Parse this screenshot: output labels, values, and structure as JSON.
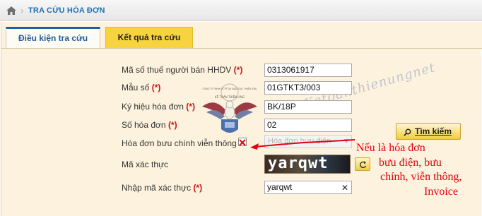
{
  "breadcrumb": {
    "title": "TRA CỨU HÓA ĐƠN",
    "home_icon": "home-icon"
  },
  "tabs": [
    {
      "label": "Điều kiện tra cứu",
      "active": true
    },
    {
      "label": "Kết quả tra cứu",
      "active": false
    }
  ],
  "form": {
    "seller_tax_code": {
      "label": "Mã số thuế người bán HHDV",
      "req": "(*)",
      "value": "0313061917"
    },
    "template_code": {
      "label": "Mẫu số",
      "req": "(*)",
      "value": "01GTKT3/003"
    },
    "serial": {
      "label": "Ký hiệu hóa đơn",
      "req": "(*)",
      "value": "BK/18P"
    },
    "invoice_no": {
      "label": "Số hóa đơn",
      "req": "(*)",
      "value": "02"
    },
    "postal_invoice": {
      "label": "Hóa đơn bưu chính viễn thông",
      "checked": true,
      "select_value": "Hóa đơn bưu điện"
    },
    "captcha": {
      "label": "Mã xác thực",
      "image_text": "yarqwt"
    },
    "captcha_input": {
      "label": "Nhập mã xác thực",
      "req": "(*)",
      "value": "yarqwt"
    }
  },
  "search_button": {
    "label": "Tìm kiếm",
    "icon": "search-icon"
  },
  "watermark": "Ketoanthienungnet",
  "logo_text": {
    "top": "CÔNG TY TNHH ĐT PT DV GIÁO DỤC THIÊN ƯNG",
    "bottom": "KẾ TOÁN THIÊN ƯNG"
  },
  "annotation": {
    "line1": "Nếu là hóa đơn",
    "line2": "bưu điện, bưu",
    "line3": "chính, viễn thông,",
    "line4": "Invoice"
  },
  "colors": {
    "accent_blue": "#1f5fa8",
    "tab_yellow": "#f7d43f",
    "panel_bg": "#fdf2de",
    "required_red": "#d01010",
    "annotation_red": "#e4000f"
  }
}
